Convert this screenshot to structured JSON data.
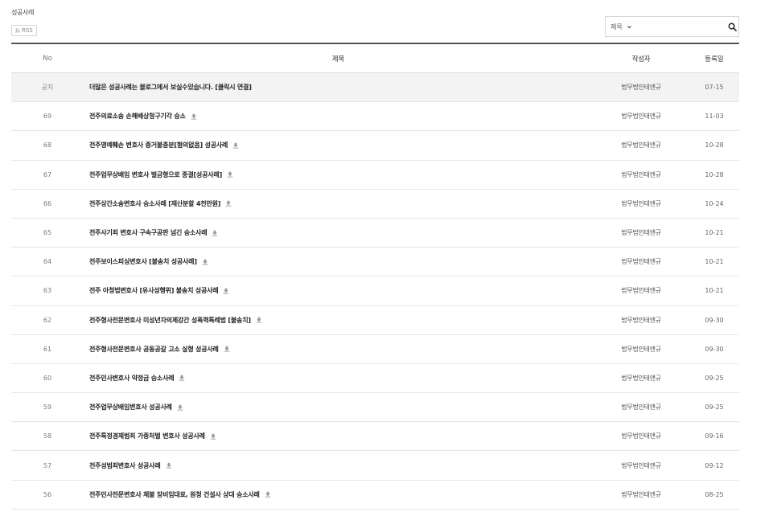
{
  "board": {
    "title": "성공사례",
    "rss_label": "RSS"
  },
  "search": {
    "select_value": "제목",
    "placeholder": ""
  },
  "columns": {
    "no": "No",
    "title": "제목",
    "author": "작성자",
    "date": "등록일"
  },
  "notice": {
    "no": "공지",
    "title": "더많은 성공사례는 블로그에서 보실수있습니다. [클릭시 연결]",
    "author": "법무법인태앤규",
    "date": "07-15"
  },
  "rows": [
    {
      "no": "69",
      "title": "전주의료소송 손해배상청구기각 승소",
      "author": "법무법인태앤규",
      "date": "11-03"
    },
    {
      "no": "68",
      "title": "전주명예훼손 변호사 증거불충분[혐의없음] 성공사례",
      "author": "법무법인태앤규",
      "date": "10-28"
    },
    {
      "no": "67",
      "title": "전주업무상배임 변호사 벌금형으로 종결[성공사례]",
      "author": "법무법인태앤규",
      "date": "10-28"
    },
    {
      "no": "66",
      "title": "전주상간소송변호사 승소사례 [재산분할 4천만원]",
      "author": "법무법인태앤규",
      "date": "10-24"
    },
    {
      "no": "65",
      "title": "전주사기죄 변호사 구속구공판 넘긴 승소사례",
      "author": "법무법인태앤규",
      "date": "10-21"
    },
    {
      "no": "64",
      "title": "전주보이스피싱변호사 [불송치 성공사례]",
      "author": "법무법인태앤규",
      "date": "10-21"
    },
    {
      "no": "63",
      "title": "전주 아청법변호사 [유사성행위] 불송치 성공사례",
      "author": "법무법인태앤규",
      "date": "10-21"
    },
    {
      "no": "62",
      "title": "전주형사전문변호사 미성년자의제강간 성폭력특례법 [불송치]",
      "author": "법무법인태앤규",
      "date": "09-30"
    },
    {
      "no": "61",
      "title": "전주형사전문변호사 공동공갈 고소 실형 성공사례",
      "author": "법무법인태앤규",
      "date": "09-30"
    },
    {
      "no": "60",
      "title": "전주민사변호사 약정금 승소사례",
      "author": "법무법인태앤규",
      "date": "09-25"
    },
    {
      "no": "59",
      "title": "전주업무상배임변호사 성공사례",
      "author": "법무법인태앤규",
      "date": "09-25"
    },
    {
      "no": "58",
      "title": "전주특정경제범죄 가중처벌 변호사 성공사례",
      "author": "법무법인태앤규",
      "date": "09-16"
    },
    {
      "no": "57",
      "title": "전주성범죄변호사 성공사례",
      "author": "법무법인태앤규",
      "date": "09-12"
    },
    {
      "no": "56",
      "title": "전주민사전문변호사 체불 장비임대료, 원청 건설사 상대 승소사례",
      "author": "법무법인태앤규",
      "date": "08-25"
    }
  ],
  "icons": {
    "attachment": "download-icon",
    "search": "search-icon",
    "rss": "rss-icon",
    "dropdown": "chevron-down-icon"
  }
}
